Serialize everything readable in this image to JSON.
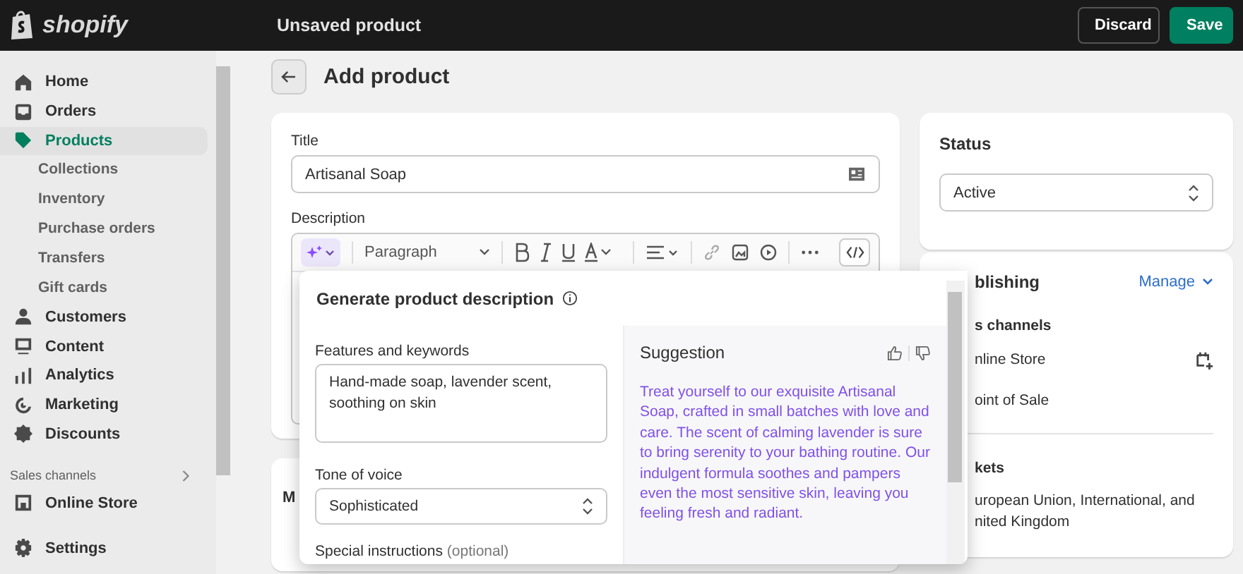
{
  "top_bar": {
    "logo": "shopify",
    "title": "Unsaved product",
    "buttons": [
      {
        "label": "Discard",
        "kind": "secondary"
      },
      {
        "label": "Save",
        "kind": "primary"
      }
    ]
  },
  "sidebar": {
    "items": [
      {
        "label": "Home",
        "selected": false
      },
      {
        "label": "Orders",
        "selected": false
      },
      {
        "label": "Products",
        "selected": true,
        "children": [
          {
            "label": "Collections"
          },
          {
            "label": "Inventory"
          },
          {
            "label": "Purchase orders"
          },
          {
            "label": "Transfers"
          },
          {
            "label": "Gift cards"
          }
        ]
      },
      {
        "label": "Customers",
        "selected": false
      },
      {
        "label": "Content",
        "selected": false
      },
      {
        "label": "Analytics",
        "selected": false
      },
      {
        "label": "Marketing",
        "selected": false
      },
      {
        "label": "Discounts",
        "selected": false
      }
    ],
    "sales_channels": {
      "heading": "Sales channels",
      "items": [
        {
          "label": "Online Store",
          "selected": false
        }
      ]
    },
    "settings": "Settings"
  },
  "page_title": "Add product",
  "product_card": {
    "title_label": "Title",
    "title_value": "Artisanal Soap",
    "description_label": "Description",
    "format": "Paragraph"
  },
  "media_card": {
    "title": "M"
  },
  "status_card": {
    "heading": "Status",
    "value": "Active"
  },
  "publishing_card": {
    "heading": "blishing",
    "manage": "Manage",
    "channels_heading": "s channels",
    "channels": [
      "nline Store",
      "oint of Sale"
    ],
    "markets_heading": "kets",
    "markets": [
      "uropean Union, International, and",
      "nited Kingdom"
    ]
  },
  "popup": {
    "title": "Generate product description",
    "features_label": "Features and keywords",
    "features_value": "Hand-made soap, lavender scent, soothing on skin",
    "tone_label": "Tone of voice",
    "tone_value": "Sophisticated",
    "special_label": "Special instructions",
    "special_optional": "(optional)",
    "suggestion_heading": "Suggestion",
    "suggestion_text": "Treat yourself to our exquisite Artisanal Soap, crafted in small batches with love and care. The scent of calming lavender is sure to bring serenity to your bathing routine. Our indulgent formula soothes and pampers even the most sensitive skin, leaving you feeling fresh and radiant."
  }
}
